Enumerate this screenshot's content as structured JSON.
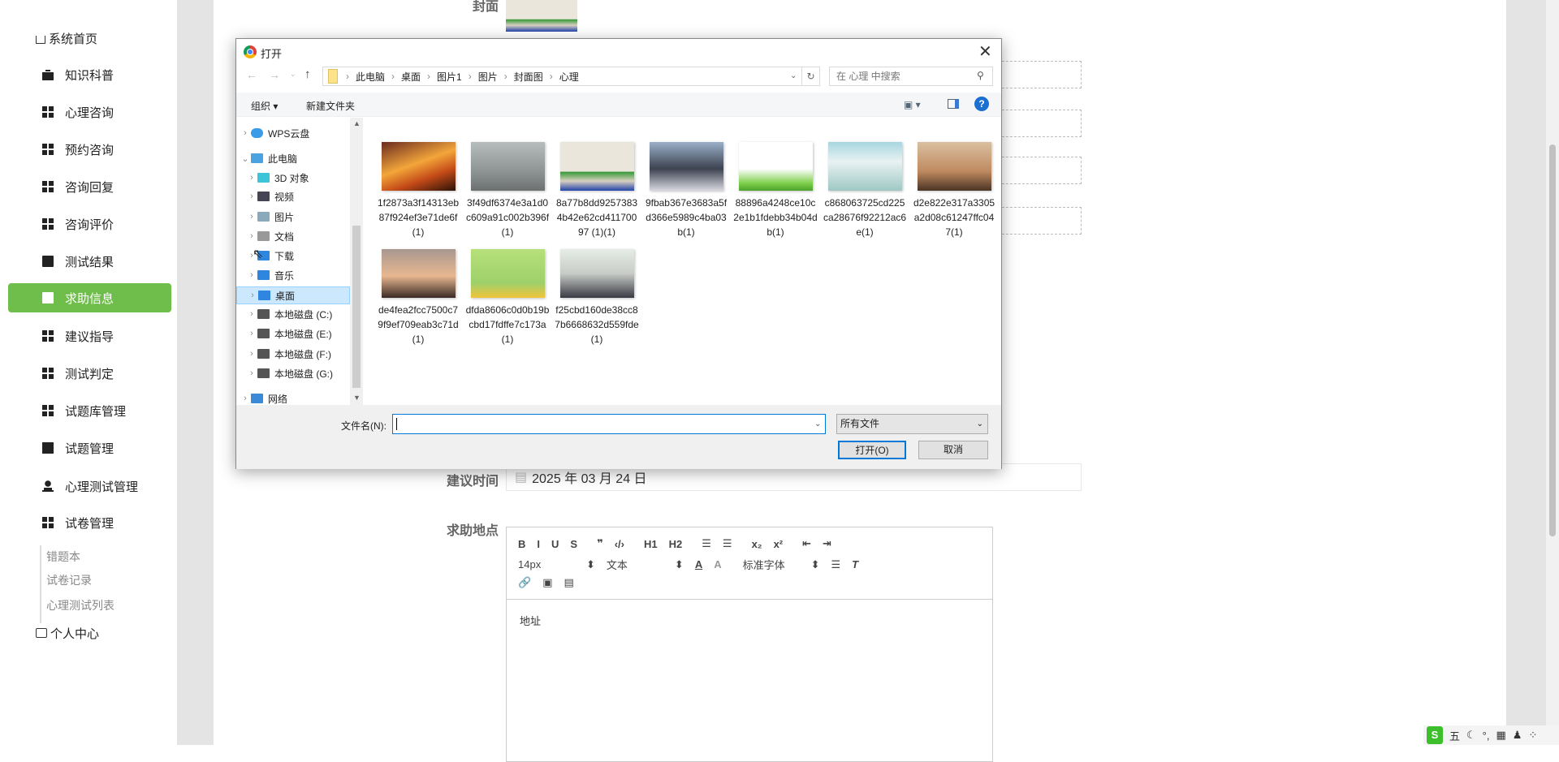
{
  "sidebar": {
    "items": [
      {
        "label": "系统首页",
        "icon": "home-icon",
        "kind": "top"
      },
      {
        "label": "知识科普",
        "icon": "briefcase-icon"
      },
      {
        "label": "心理咨询",
        "icon": "grid-icon"
      },
      {
        "label": "预约咨询",
        "icon": "grid-icon"
      },
      {
        "label": "咨询回复",
        "icon": "grid-icon"
      },
      {
        "label": "咨询评价",
        "icon": "grid-icon"
      },
      {
        "label": "测试结果",
        "icon": "clipboard-x-icon"
      },
      {
        "label": "求助信息",
        "icon": "clipboard-icon",
        "active": true
      },
      {
        "label": "建议指导",
        "icon": "grid-icon"
      },
      {
        "label": "测试判定",
        "icon": "grid-icon"
      },
      {
        "label": "试题库管理",
        "icon": "grid-icon"
      },
      {
        "label": "试题管理",
        "icon": "chart-icon"
      },
      {
        "label": "心理测试管理",
        "icon": "user-icon"
      },
      {
        "label": "试卷管理",
        "icon": "grid-icon"
      }
    ],
    "sub_items": [
      "错题本",
      "试卷记录",
      "心理测试列表"
    ],
    "personal": {
      "label": "个人中心",
      "icon": "wallet-icon"
    }
  },
  "form": {
    "cover_label": "封面",
    "date_label": "建议时间",
    "date_value": "2025 年 03 月 24 日",
    "location_label": "求助地点",
    "editor": {
      "row1": [
        "B",
        "I",
        "U",
        "S",
        "❞",
        "‹/›",
        "H1",
        "H2",
        "☰",
        "☰",
        "x₂",
        "x²",
        "⇤",
        "⇥"
      ],
      "font_size": "14px",
      "block": "文本",
      "font": "标准字体",
      "row3": [
        "🔗",
        "▣",
        "▤"
      ],
      "content": "地址"
    }
  },
  "dialog": {
    "title": "打开",
    "path": [
      "此电脑",
      "桌面",
      "图片1",
      "图片",
      "封面图",
      "心理"
    ],
    "search_placeholder": "在 心理 中搜索",
    "organize": "组织 ▾",
    "new_folder": "新建文件夹",
    "tree": [
      {
        "label": "WPS云盘",
        "level": 0,
        "icon": "cloud-icon",
        "color": "#3a9be8"
      },
      {
        "label": "此电脑",
        "level": 0,
        "icon": "computer-icon",
        "expanded": true,
        "color": "#4aa3e0"
      },
      {
        "label": "3D 对象",
        "level": 1,
        "icon": "cube-icon",
        "color": "#3cc4d8"
      },
      {
        "label": "视频",
        "level": 1,
        "icon": "film-icon",
        "color": "#445"
      },
      {
        "label": "图片",
        "level": 1,
        "icon": "picture-icon",
        "color": "#8ab"
      },
      {
        "label": "文档",
        "level": 1,
        "icon": "document-icon",
        "color": "#999"
      },
      {
        "label": "下载",
        "level": 1,
        "icon": "download-icon",
        "color": "#2f86e0"
      },
      {
        "label": "音乐",
        "level": 1,
        "icon": "music-icon",
        "color": "#2f86e0"
      },
      {
        "label": "桌面",
        "level": 1,
        "icon": "desktop-icon",
        "selected": true,
        "color": "#2f86e0"
      },
      {
        "label": "本地磁盘 (C:)",
        "level": 1,
        "icon": "drive-icon",
        "color": "#555"
      },
      {
        "label": "本地磁盘 (E:)",
        "level": 1,
        "icon": "drive-icon",
        "color": "#555"
      },
      {
        "label": "本地磁盘 (F:)",
        "level": 1,
        "icon": "drive-icon",
        "color": "#555"
      },
      {
        "label": "本地磁盘 (G:)",
        "level": 1,
        "icon": "drive-icon",
        "color": "#555"
      },
      {
        "label": "网络",
        "level": 0,
        "icon": "network-icon",
        "color": "#3a8ad8"
      }
    ],
    "files": [
      "1f2873a3f14313eb87f924ef3e71de6f(1)",
      "3f49df6374e3a1d0c609a91c002b396f(1)",
      "8a77b8dd92573834b42e62cd41170097 (1)(1)",
      "9fbab367e3683a5fd366e5989c4ba03b(1)",
      "88896a4248ce10c2e1b1fdebb34b04db(1)",
      "c868063725cd225ca28676f92212ac6e(1)",
      "d2e822e317a3305a2d08c61247ffc047(1)",
      "de4fea2fcc7500c79f9ef709eab3c71d(1)",
      "dfda8606c0d0b19bcbd17fdffe7c173a(1)",
      "f25cbd160de38cc87b6668632d559fde(1)"
    ],
    "filename_label": "文件名(N):",
    "filename_value": "",
    "filter": "所有文件",
    "open": "打开(O)",
    "cancel": "取消"
  },
  "ime": {
    "mode": "五"
  }
}
